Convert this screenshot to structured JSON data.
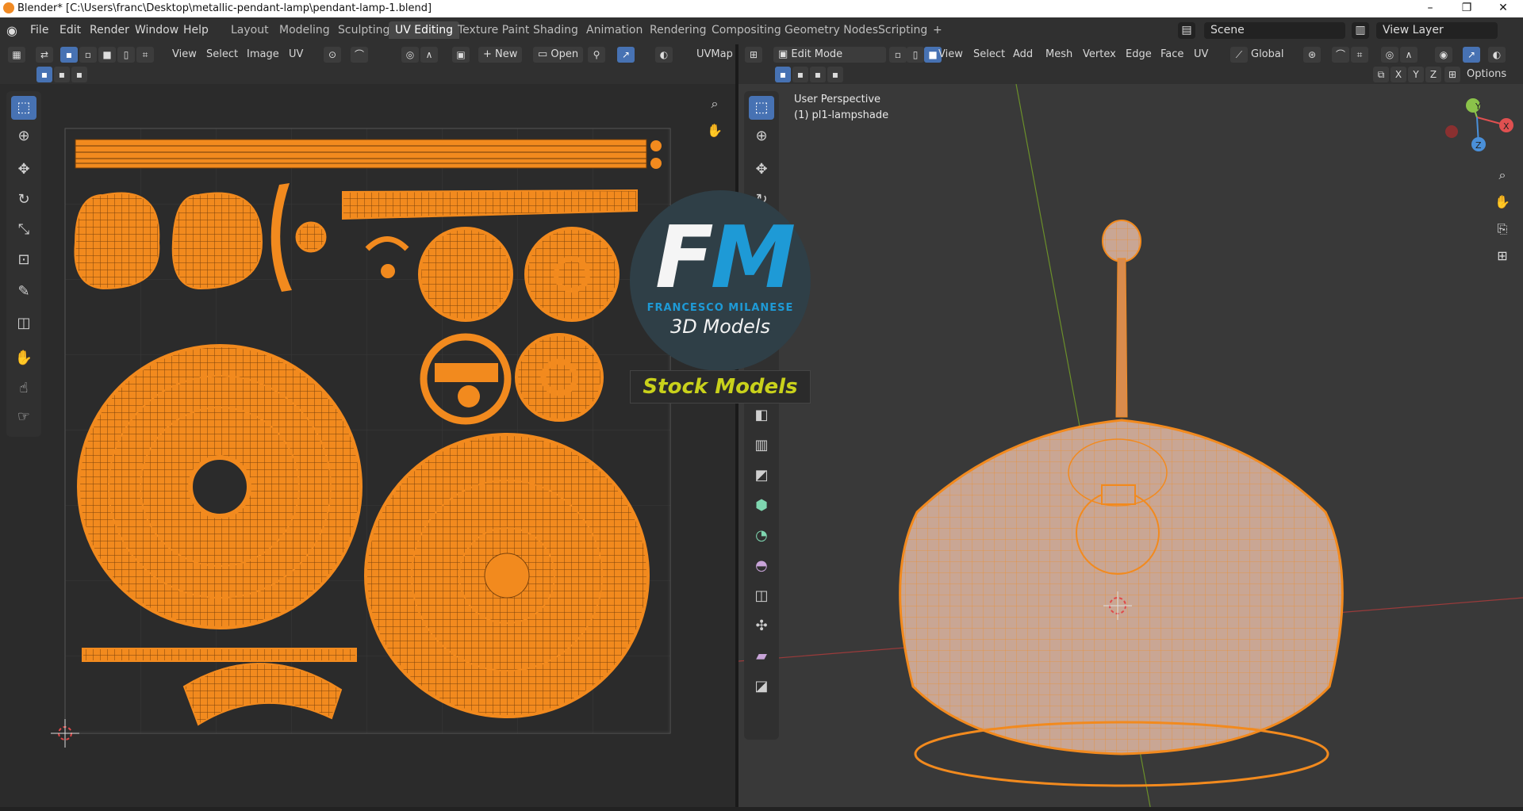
{
  "window": {
    "title": "Blender* [C:\\Users\\franc\\Desktop\\metallic-pendant-lamp\\pendant-lamp-1.blend]",
    "minimize": "–",
    "maximize": "❐",
    "close": "✕"
  },
  "menu": [
    "File",
    "Edit",
    "Render",
    "Window",
    "Help"
  ],
  "workspaces": [
    "Layout",
    "Modeling",
    "Sculpting",
    "UV Editing",
    "Texture Paint",
    "Shading",
    "Animation",
    "Rendering",
    "Compositing",
    "Geometry Nodes",
    "Scripting",
    "+"
  ],
  "active_workspace": "UV Editing",
  "scene": {
    "name": "Scene",
    "view_layer": "View Layer"
  },
  "uv_editor": {
    "menus": [
      "View",
      "Select",
      "Image",
      "UV"
    ],
    "new_label": "New",
    "open_label": "Open",
    "uvmap": "UVMap"
  },
  "viewport": {
    "mode": "Edit Mode",
    "menus": [
      "View",
      "Select",
      "Add",
      "Mesh",
      "Vertex",
      "Edge",
      "Face",
      "UV"
    ],
    "orientation": "Global",
    "options_label": "Options",
    "axes": [
      "X",
      "Y",
      "Z"
    ],
    "perspective_label": "User Perspective",
    "object_label": "(1) pl1-lampshade"
  },
  "gizmo_axes": {
    "x": "X",
    "y": "Y",
    "z": "Z"
  },
  "watermark": {
    "f": "F",
    "m": "M",
    "author": "FRANCESCO MILANESE",
    "models": "3D Models",
    "stock": "Stock Models"
  },
  "colors": {
    "accent_blue": "#4772b3",
    "uv_orange": "#f28a1e",
    "brand_blue": "#1e9ad6",
    "stock_yellow": "#c9d11b"
  }
}
